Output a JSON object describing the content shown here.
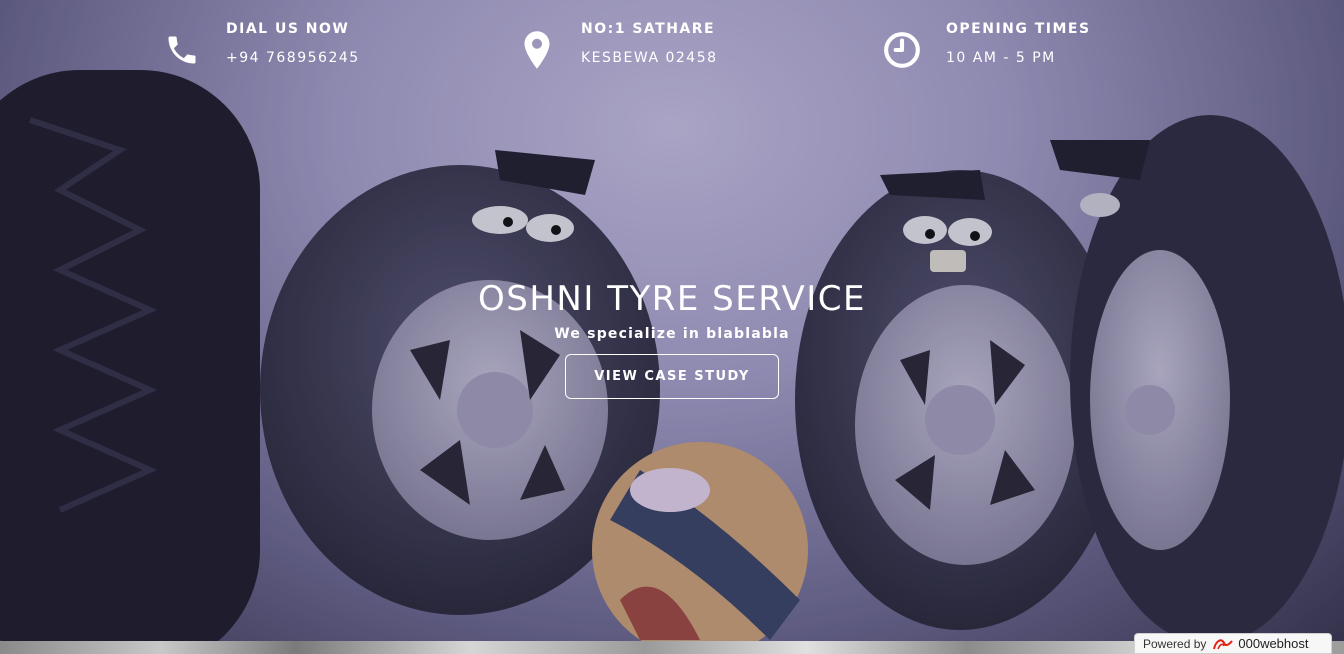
{
  "topbar": {
    "phone": {
      "label": "DIAL US NOW",
      "value": "+94 768956245",
      "icon": "phone-icon"
    },
    "address": {
      "label": "NO:1 SATHARE",
      "value": "KESBEWA 02458",
      "icon": "map-pin-icon"
    },
    "hours": {
      "label": "OPENING TIMES",
      "value": "10 AM - 5 PM",
      "icon": "clock-icon"
    }
  },
  "hero": {
    "title": "OSHNI TYRE SERVICE",
    "subtitle": "We specialize in blablabla",
    "cta_label": "VIEW CASE STUDY"
  },
  "footer": {
    "powered_by": "Powered by",
    "brand": "000webhost",
    "brand_color": "#e2231a"
  },
  "colors": {
    "text": "#ffffff",
    "background": "#a8a2cc"
  }
}
